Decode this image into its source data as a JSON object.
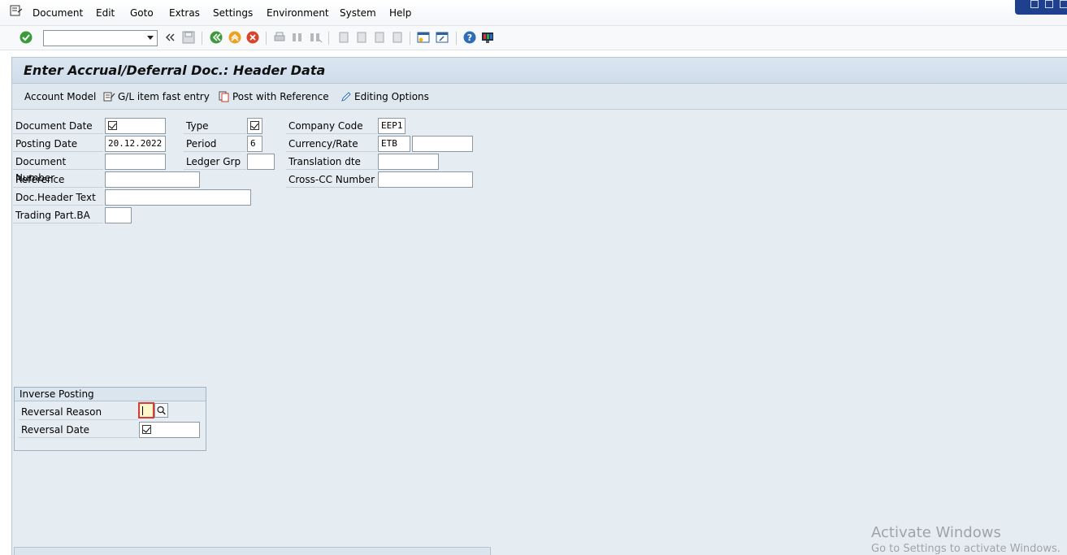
{
  "menu": {
    "items": [
      "Document",
      "Edit",
      "Goto",
      "Extras",
      "Settings",
      "Environment",
      "System",
      "Help"
    ]
  },
  "toolbar": {
    "command_value": ""
  },
  "page": {
    "title": "Enter Accrual/Deferral Doc.: Header Data"
  },
  "app_toolbar": {
    "account_model": "Account Model",
    "gl_fast_entry": "G/L item fast entry",
    "post_with_reference": "Post with Reference",
    "editing_options": "Editing Options"
  },
  "header": {
    "document_date": {
      "label": "Document Date",
      "value": ""
    },
    "type": {
      "label": "Type",
      "value": ""
    },
    "company_code": {
      "label": "Company Code",
      "value": "EEP1"
    },
    "posting_date": {
      "label": "Posting Date",
      "value": "20.12.2022"
    },
    "period": {
      "label": "Period",
      "value": "6"
    },
    "currency_rate": {
      "label": "Currency/Rate",
      "value": "ETB",
      "rate": ""
    },
    "document_number": {
      "label": "Document Number",
      "value": ""
    },
    "ledger_grp": {
      "label": "Ledger Grp",
      "value": ""
    },
    "translation_dte": {
      "label": "Translation dte",
      "value": ""
    },
    "reference": {
      "label": "Reference",
      "value": ""
    },
    "cross_cc_number": {
      "label": "Cross-CC Number",
      "value": ""
    },
    "doc_header_text": {
      "label": "Doc.Header Text",
      "value": ""
    },
    "trading_part_ba": {
      "label": "Trading Part.BA",
      "value": ""
    }
  },
  "inverse_posting": {
    "title": "Inverse Posting",
    "reversal_reason": {
      "label": "Reversal Reason",
      "value": ""
    },
    "reversal_date": {
      "label": "Reversal Date",
      "value": ""
    }
  },
  "watermark": {
    "line1": "Activate Windows",
    "line2": "Go to Settings to activate Windows."
  }
}
